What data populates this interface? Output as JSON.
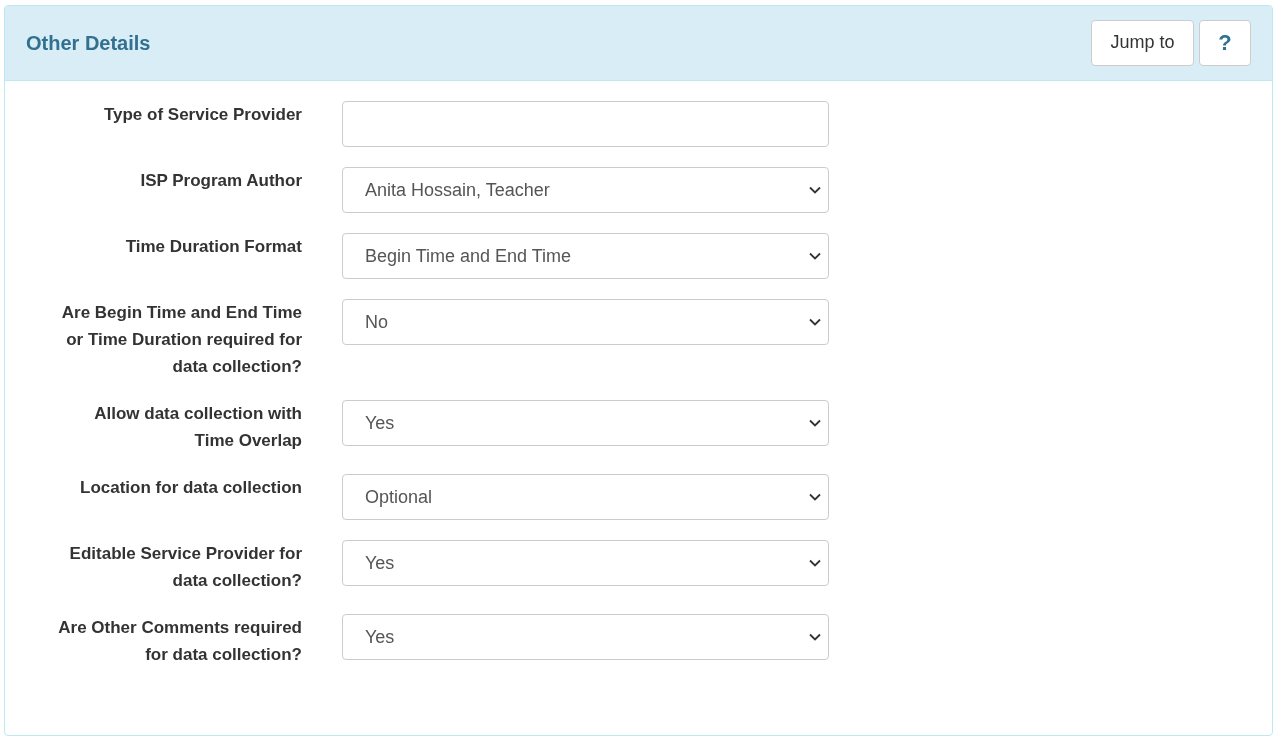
{
  "panel": {
    "title": "Other Details",
    "buttons": [
      {
        "label": "Jump to",
        "kind": "text"
      },
      {
        "label": "?",
        "kind": "help"
      }
    ]
  },
  "fields": [
    {
      "label": "Type of Service Provider",
      "kind": "text"
    },
    {
      "label": "ISP Program Author",
      "kind": "select",
      "value": "Anita Hossain, Teacher"
    },
    {
      "label": "Time Duration Format",
      "kind": "select",
      "value": "Begin Time and End Time"
    },
    {
      "label": "Are Begin Time and End Time\nor Time Duration required for\ndata collection?",
      "kind": "select",
      "value": "No"
    },
    {
      "label": "Allow data collection with\nTime Overlap",
      "kind": "select",
      "value": "Yes"
    },
    {
      "label": "Location for data collection",
      "kind": "select",
      "value": "Optional"
    },
    {
      "label": "Editable Service Provider for\ndata collection?",
      "kind": "select",
      "value": "Yes"
    },
    {
      "label": "Are Other Comments required\nfor data collection?",
      "kind": "select",
      "value": "Yes"
    }
  ]
}
